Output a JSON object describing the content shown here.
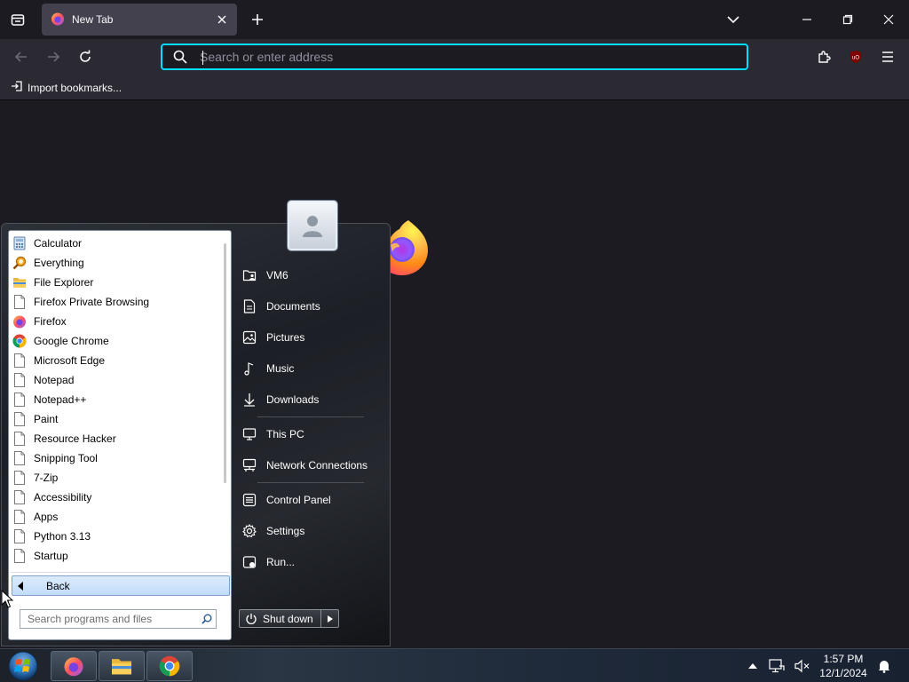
{
  "browser": {
    "tab": {
      "title": "New Tab"
    },
    "urlbar": {
      "placeholder": "Search or enter address",
      "value": ""
    },
    "bookmarks": {
      "import_label": "Import bookmarks..."
    },
    "colors": {
      "accent": "#00ddff",
      "toolbar": "#2b2a33",
      "background": "#1c1b22"
    }
  },
  "start_menu": {
    "programs": [
      {
        "label": "Calculator",
        "icon": "calculator-icon"
      },
      {
        "label": "Everything",
        "icon": "everything-search-icon"
      },
      {
        "label": "File Explorer",
        "icon": "folder-icon"
      },
      {
        "label": "Firefox Private Browsing",
        "icon": "document-icon"
      },
      {
        "label": "Firefox",
        "icon": "firefox-icon"
      },
      {
        "label": "Google Chrome",
        "icon": "chrome-icon"
      },
      {
        "label": "Microsoft Edge",
        "icon": "document-icon"
      },
      {
        "label": "Notepad",
        "icon": "document-icon"
      },
      {
        "label": "Notepad++",
        "icon": "document-icon"
      },
      {
        "label": "Paint",
        "icon": "document-icon"
      },
      {
        "label": "Resource Hacker",
        "icon": "document-icon"
      },
      {
        "label": "Snipping Tool",
        "icon": "document-icon"
      },
      {
        "label": "7-Zip",
        "icon": "document-icon"
      },
      {
        "label": "Accessibility",
        "icon": "document-icon"
      },
      {
        "label": "Apps",
        "icon": "document-icon"
      },
      {
        "label": "Python 3.13",
        "icon": "document-icon"
      },
      {
        "label": "Startup",
        "icon": "document-icon"
      }
    ],
    "back_label": "Back",
    "search_placeholder": "Search programs and files",
    "right_items": [
      {
        "label": "VM6",
        "icon": "user-folder-icon"
      },
      {
        "label": "Documents",
        "icon": "document-icon"
      },
      {
        "label": "Pictures",
        "icon": "picture-icon"
      },
      {
        "label": "Music",
        "icon": "music-icon"
      },
      {
        "label": "Downloads",
        "icon": "download-icon"
      },
      {
        "label": "This PC",
        "icon": "computer-icon"
      },
      {
        "label": "Network Connections",
        "icon": "network-icon"
      },
      {
        "label": "Control Panel",
        "icon": "control-panel-icon"
      },
      {
        "label": "Settings",
        "icon": "gear-icon"
      },
      {
        "label": "Run...",
        "icon": "run-icon"
      }
    ],
    "shutdown_label": "Shut down"
  },
  "taskbar": {
    "apps": [
      "firefox",
      "file-explorer",
      "chrome"
    ],
    "clock": {
      "time": "1:57 PM",
      "date": "12/1/2024"
    }
  }
}
